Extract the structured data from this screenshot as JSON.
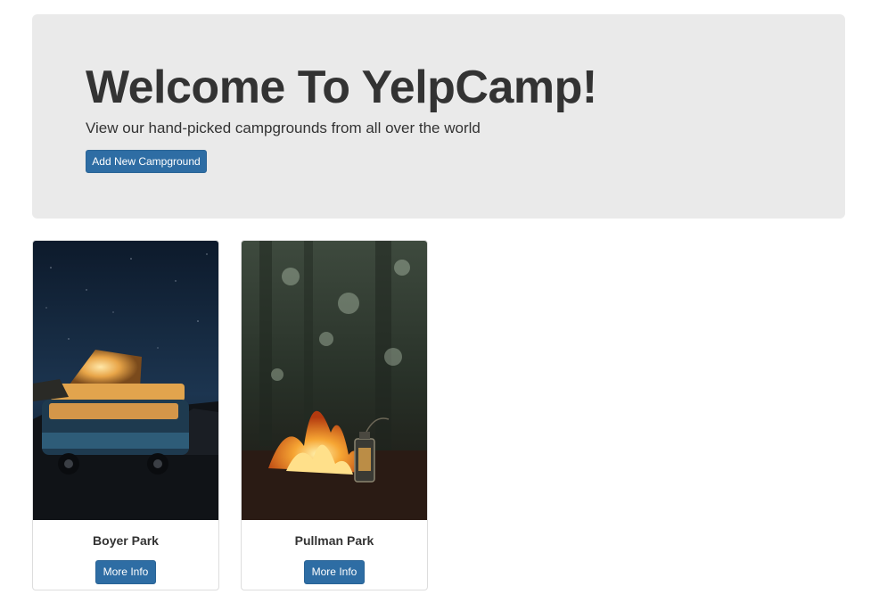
{
  "jumbotron": {
    "title": "Welcome To YelpCamp!",
    "subtitle": "View our hand-picked campgrounds from all over the world",
    "add_button_label": "Add New Campground"
  },
  "campgrounds": [
    {
      "name": "Boyer Park",
      "button_label": "More Info",
      "image": "van-night-image"
    },
    {
      "name": "Pullman Park",
      "button_label": "More Info",
      "image": "campfire-lantern-image"
    }
  ],
  "colors": {
    "primary": "#2e6da4",
    "jumbotron_bg": "#eaeaea",
    "text": "#333333"
  }
}
